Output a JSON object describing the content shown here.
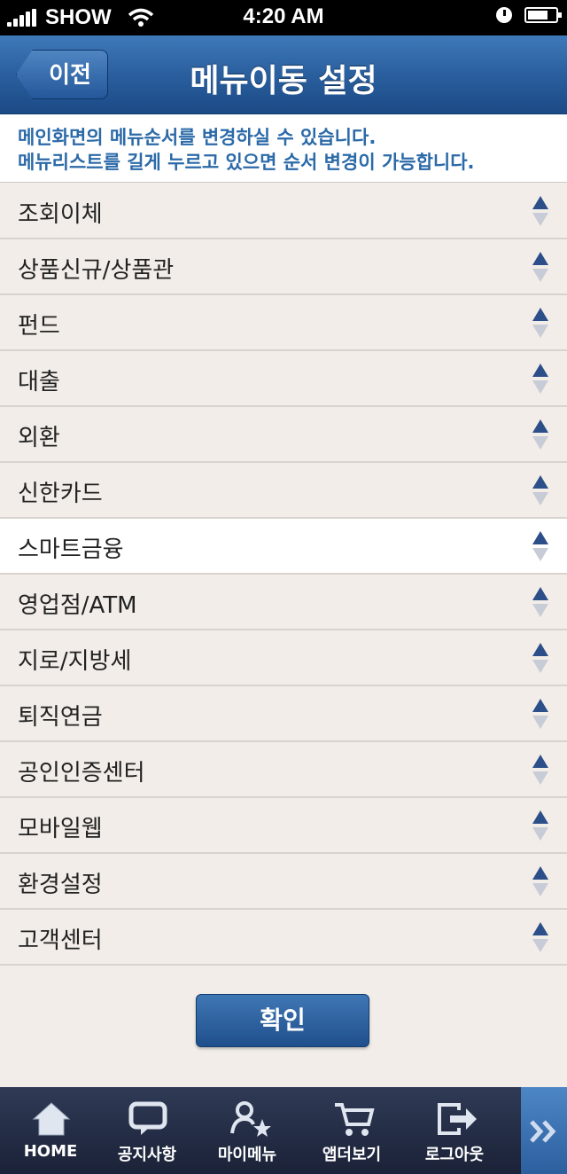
{
  "status_bar": {
    "carrier": "SHOW",
    "time": "4:20 AM"
  },
  "header": {
    "back_label": "이전",
    "title": "메뉴이동 설정"
  },
  "notice": {
    "line1": "메인화면의 메뉴순서를 변경하실 수 있습니다.",
    "line2": "메뉴리스트를 길게 누르고 있으면 순서 변경이 가능합니다."
  },
  "menu_items": [
    {
      "label": "조회이체"
    },
    {
      "label": "상품신규/상품관"
    },
    {
      "label": "펀드"
    },
    {
      "label": "대출"
    },
    {
      "label": "외환"
    },
    {
      "label": "신한카드"
    },
    {
      "label": "스마트금융"
    },
    {
      "label": "영업점/ATM"
    },
    {
      "label": "지로/지방세"
    },
    {
      "label": "퇴직연금"
    },
    {
      "label": "공인인증센터"
    },
    {
      "label": "모바일웹"
    },
    {
      "label": "환경설정"
    },
    {
      "label": "고객센터"
    }
  ],
  "highlighted_item": "스마트금융",
  "confirm_label": "확인",
  "tab_bar": {
    "home": "HOME",
    "notice": "공지사항",
    "my_menu": "마이메뉴",
    "app_store": "앱더보기",
    "logout": "로그아웃"
  },
  "colors": {
    "accent": "#2a5f9e",
    "notice_text": "#2b6aa8",
    "tab_bg": "#1b2238"
  }
}
